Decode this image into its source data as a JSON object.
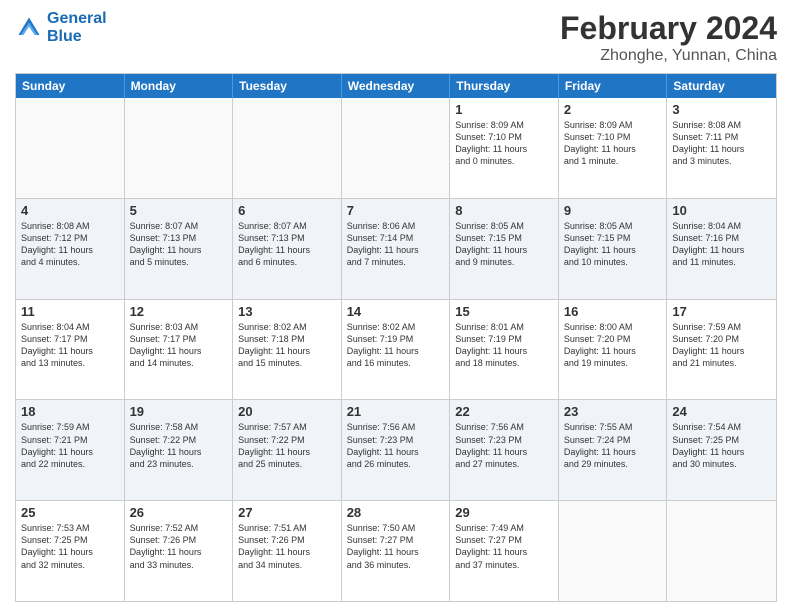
{
  "header": {
    "logo_line1": "General",
    "logo_line2": "Blue",
    "title": "February 2024",
    "subtitle": "Zhonghe, Yunnan, China"
  },
  "weekdays": [
    "Sunday",
    "Monday",
    "Tuesday",
    "Wednesday",
    "Thursday",
    "Friday",
    "Saturday"
  ],
  "rows": [
    {
      "alt": false,
      "cells": [
        {
          "day": "",
          "text": ""
        },
        {
          "day": "",
          "text": ""
        },
        {
          "day": "",
          "text": ""
        },
        {
          "day": "",
          "text": ""
        },
        {
          "day": "1",
          "text": "Sunrise: 8:09 AM\nSunset: 7:10 PM\nDaylight: 11 hours\nand 0 minutes."
        },
        {
          "day": "2",
          "text": "Sunrise: 8:09 AM\nSunset: 7:10 PM\nDaylight: 11 hours\nand 1 minute."
        },
        {
          "day": "3",
          "text": "Sunrise: 8:08 AM\nSunset: 7:11 PM\nDaylight: 11 hours\nand 3 minutes."
        }
      ]
    },
    {
      "alt": true,
      "cells": [
        {
          "day": "4",
          "text": "Sunrise: 8:08 AM\nSunset: 7:12 PM\nDaylight: 11 hours\nand 4 minutes."
        },
        {
          "day": "5",
          "text": "Sunrise: 8:07 AM\nSunset: 7:13 PM\nDaylight: 11 hours\nand 5 minutes."
        },
        {
          "day": "6",
          "text": "Sunrise: 8:07 AM\nSunset: 7:13 PM\nDaylight: 11 hours\nand 6 minutes."
        },
        {
          "day": "7",
          "text": "Sunrise: 8:06 AM\nSunset: 7:14 PM\nDaylight: 11 hours\nand 7 minutes."
        },
        {
          "day": "8",
          "text": "Sunrise: 8:05 AM\nSunset: 7:15 PM\nDaylight: 11 hours\nand 9 minutes."
        },
        {
          "day": "9",
          "text": "Sunrise: 8:05 AM\nSunset: 7:15 PM\nDaylight: 11 hours\nand 10 minutes."
        },
        {
          "day": "10",
          "text": "Sunrise: 8:04 AM\nSunset: 7:16 PM\nDaylight: 11 hours\nand 11 minutes."
        }
      ]
    },
    {
      "alt": false,
      "cells": [
        {
          "day": "11",
          "text": "Sunrise: 8:04 AM\nSunset: 7:17 PM\nDaylight: 11 hours\nand 13 minutes."
        },
        {
          "day": "12",
          "text": "Sunrise: 8:03 AM\nSunset: 7:17 PM\nDaylight: 11 hours\nand 14 minutes."
        },
        {
          "day": "13",
          "text": "Sunrise: 8:02 AM\nSunset: 7:18 PM\nDaylight: 11 hours\nand 15 minutes."
        },
        {
          "day": "14",
          "text": "Sunrise: 8:02 AM\nSunset: 7:19 PM\nDaylight: 11 hours\nand 16 minutes."
        },
        {
          "day": "15",
          "text": "Sunrise: 8:01 AM\nSunset: 7:19 PM\nDaylight: 11 hours\nand 18 minutes."
        },
        {
          "day": "16",
          "text": "Sunrise: 8:00 AM\nSunset: 7:20 PM\nDaylight: 11 hours\nand 19 minutes."
        },
        {
          "day": "17",
          "text": "Sunrise: 7:59 AM\nSunset: 7:20 PM\nDaylight: 11 hours\nand 21 minutes."
        }
      ]
    },
    {
      "alt": true,
      "cells": [
        {
          "day": "18",
          "text": "Sunrise: 7:59 AM\nSunset: 7:21 PM\nDaylight: 11 hours\nand 22 minutes."
        },
        {
          "day": "19",
          "text": "Sunrise: 7:58 AM\nSunset: 7:22 PM\nDaylight: 11 hours\nand 23 minutes."
        },
        {
          "day": "20",
          "text": "Sunrise: 7:57 AM\nSunset: 7:22 PM\nDaylight: 11 hours\nand 25 minutes."
        },
        {
          "day": "21",
          "text": "Sunrise: 7:56 AM\nSunset: 7:23 PM\nDaylight: 11 hours\nand 26 minutes."
        },
        {
          "day": "22",
          "text": "Sunrise: 7:56 AM\nSunset: 7:23 PM\nDaylight: 11 hours\nand 27 minutes."
        },
        {
          "day": "23",
          "text": "Sunrise: 7:55 AM\nSunset: 7:24 PM\nDaylight: 11 hours\nand 29 minutes."
        },
        {
          "day": "24",
          "text": "Sunrise: 7:54 AM\nSunset: 7:25 PM\nDaylight: 11 hours\nand 30 minutes."
        }
      ]
    },
    {
      "alt": false,
      "cells": [
        {
          "day": "25",
          "text": "Sunrise: 7:53 AM\nSunset: 7:25 PM\nDaylight: 11 hours\nand 32 minutes."
        },
        {
          "day": "26",
          "text": "Sunrise: 7:52 AM\nSunset: 7:26 PM\nDaylight: 11 hours\nand 33 minutes."
        },
        {
          "day": "27",
          "text": "Sunrise: 7:51 AM\nSunset: 7:26 PM\nDaylight: 11 hours\nand 34 minutes."
        },
        {
          "day": "28",
          "text": "Sunrise: 7:50 AM\nSunset: 7:27 PM\nDaylight: 11 hours\nand 36 minutes."
        },
        {
          "day": "29",
          "text": "Sunrise: 7:49 AM\nSunset: 7:27 PM\nDaylight: 11 hours\nand 37 minutes."
        },
        {
          "day": "",
          "text": ""
        },
        {
          "day": "",
          "text": ""
        }
      ]
    }
  ]
}
